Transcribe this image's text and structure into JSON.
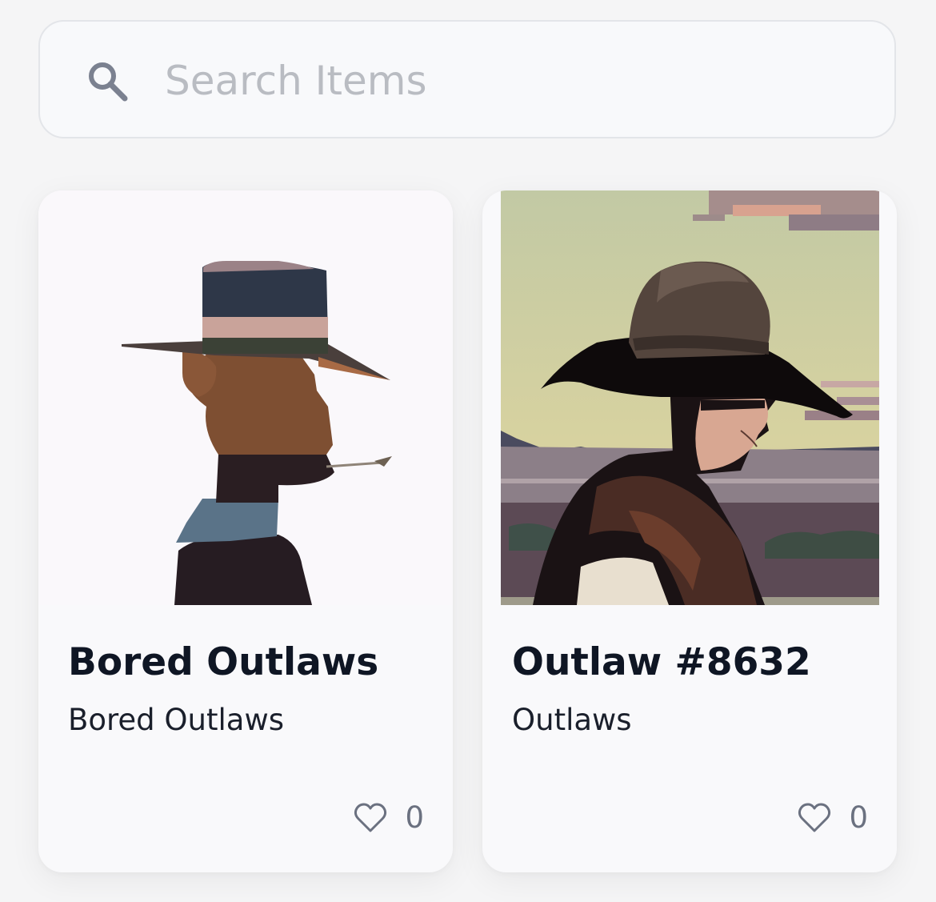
{
  "search": {
    "placeholder": "Search Items",
    "value": "",
    "icon": "search-icon"
  },
  "cards": [
    {
      "title": "Bored Outlaws",
      "collection": "Bored Outlaws",
      "likes": "0",
      "like_icon": "heart-outline-icon",
      "image": "cowboy-silhouette-profile"
    },
    {
      "title": "Outlaw #8632",
      "collection": "Outlaws",
      "likes": "0",
      "like_icon": "heart-outline-icon",
      "image": "cowboy-desert-landscape"
    }
  ],
  "colors": {
    "background": "#f5f5f6",
    "card": "#f9f9fb",
    "title": "#0f1624",
    "placeholder": "#b9bcc2",
    "muted": "#6b7180"
  }
}
